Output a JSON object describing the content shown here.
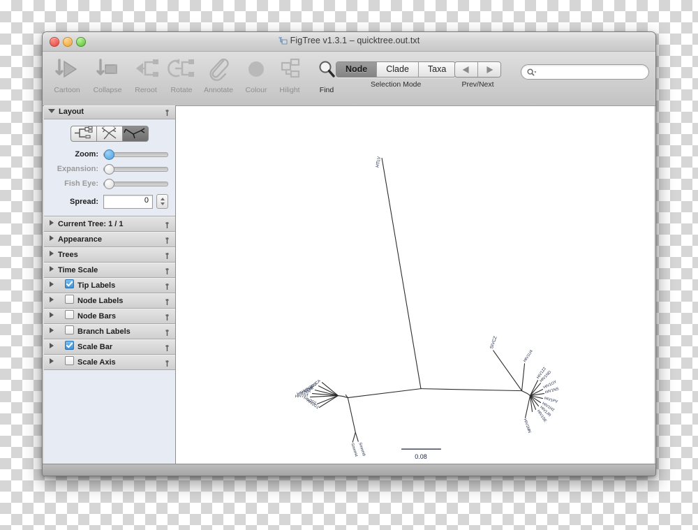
{
  "window": {
    "title": "FigTree v1.3.1 – quicktree.out.txt",
    "title_icon": "figtree-app-icon",
    "traffic": {
      "close": "close-button",
      "minimize": "minimize-button",
      "zoom": "zoom-button"
    }
  },
  "toolbar": {
    "items": [
      {
        "label": "Cartoon",
        "icon": "cartoon-icon",
        "enabled": false
      },
      {
        "label": "Collapse",
        "icon": "collapse-icon",
        "enabled": false
      },
      {
        "label": "Reroot",
        "icon": "reroot-icon",
        "enabled": false
      },
      {
        "label": "Rotate",
        "icon": "rotate-icon",
        "enabled": false
      },
      {
        "label": "Annotate",
        "icon": "annotate-icon",
        "enabled": false
      },
      {
        "label": "Colour",
        "icon": "colour-icon",
        "enabled": false
      },
      {
        "label": "Hilight",
        "icon": "hilight-icon",
        "enabled": false
      },
      {
        "label": "Find",
        "icon": "find-icon",
        "enabled": true
      }
    ],
    "selection_mode": {
      "caption": "Selection Mode",
      "options": [
        "Node",
        "Clade",
        "Taxa"
      ],
      "selected": "Node"
    },
    "prev_next": {
      "caption": "Prev/Next",
      "prev_icon": "arrow-left-icon",
      "next_icon": "arrow-right-icon"
    },
    "search": {
      "icon": "search-icon",
      "value": "",
      "placeholder": ""
    }
  },
  "sidebar": {
    "layout_panel": {
      "title": "Layout",
      "pin_icon": "pin-icon",
      "layout_buttons": [
        {
          "name": "rectangular-layout",
          "selected": false
        },
        {
          "name": "polar-layout",
          "selected": false
        },
        {
          "name": "radial-layout",
          "selected": true
        }
      ],
      "sliders": [
        {
          "label": "Zoom:",
          "enabled": true,
          "value": 0
        },
        {
          "label": "Expansion:",
          "enabled": false,
          "value": 0
        },
        {
          "label": "Fish Eye:",
          "enabled": false,
          "value": 0
        }
      ],
      "spread": {
        "label": "Spread:",
        "value": "0"
      }
    },
    "sections": [
      {
        "label": "Current Tree: 1 / 1",
        "checkbox": null,
        "indent": false
      },
      {
        "label": "Appearance",
        "checkbox": null,
        "indent": false
      },
      {
        "label": "Trees",
        "checkbox": null,
        "indent": false
      },
      {
        "label": "Time Scale",
        "checkbox": null,
        "indent": false
      },
      {
        "label": "Tip Labels",
        "checkbox": true,
        "indent": true
      },
      {
        "label": "Node Labels",
        "checkbox": false,
        "indent": true
      },
      {
        "label": "Node Bars",
        "checkbox": false,
        "indent": true
      },
      {
        "label": "Branch Labels",
        "checkbox": false,
        "indent": true
      },
      {
        "label": "Scale Bar",
        "checkbox": true,
        "indent": true
      },
      {
        "label": "Scale Axis",
        "checkbox": false,
        "indent": true
      }
    ]
  },
  "tree": {
    "scale_bar": {
      "label": "0.08"
    },
    "tip_labels": [
      "HTLV",
      "HIV2CA",
      "HIV2RO",
      "HIV2SB",
      "HIV2KR",
      "HIV2ST",
      "HIV2D1",
      "HIV2G1",
      "SmmH4",
      "SmmH9",
      "SIVCZ",
      "HIV1U4",
      "HIV1Z2",
      "HIV1ND",
      "HIV1OY",
      "HIV1NS",
      "HIV1PV",
      "HIV1H2",
      "HIV1JR",
      "HIV1SE",
      "HIV1MN"
    ],
    "colors": {
      "branch": "#2b2b2b",
      "label": "#1a2340"
    }
  }
}
